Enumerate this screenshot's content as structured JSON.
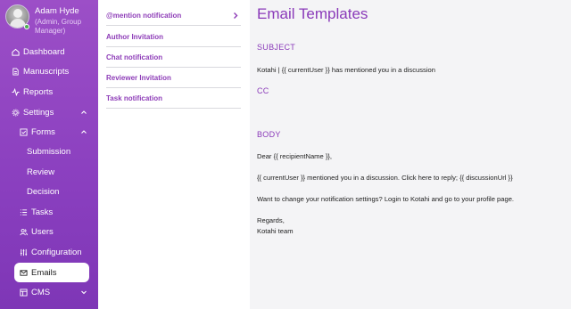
{
  "user": {
    "name": "Adam Hyde",
    "role": "(Admin, Group Manager)"
  },
  "nav": {
    "dashboard": "Dashboard",
    "manuscripts": "Manuscripts",
    "reports": "Reports",
    "settings": "Settings",
    "forms": "Forms",
    "submission": "Submission",
    "review": "Review",
    "decision": "Decision",
    "tasks": "Tasks",
    "users": "Users",
    "configuration": "Configuration",
    "emails": "Emails",
    "cms": "CMS"
  },
  "templates": [
    {
      "label": "@mention notification"
    },
    {
      "label": "Author Invitation"
    },
    {
      "label": "Chat notification"
    },
    {
      "label": "Reviewer Invitation"
    },
    {
      "label": "Task notification"
    }
  ],
  "main": {
    "title": "Email Templates",
    "subject_label": "SUBJECT",
    "subject_value": "Kotahi | {{ currentUser }} has mentioned you in a discussion",
    "cc_label": "CC",
    "body_label": "BODY",
    "body_lines": [
      "Dear {{ recipientName }},",
      "{{ currentUser }} mentioned you in a discussion. Click here to reply; {{ discussionUrl }}",
      "Want to change your notification settings? Login to Kotahi and go to your profile page.",
      "Regards,",
      "Kotahi team"
    ]
  },
  "colors": {
    "accent": "#8a3ab9",
    "sidebar": "#9c4fc7",
    "active_bg": "#ffffff"
  }
}
